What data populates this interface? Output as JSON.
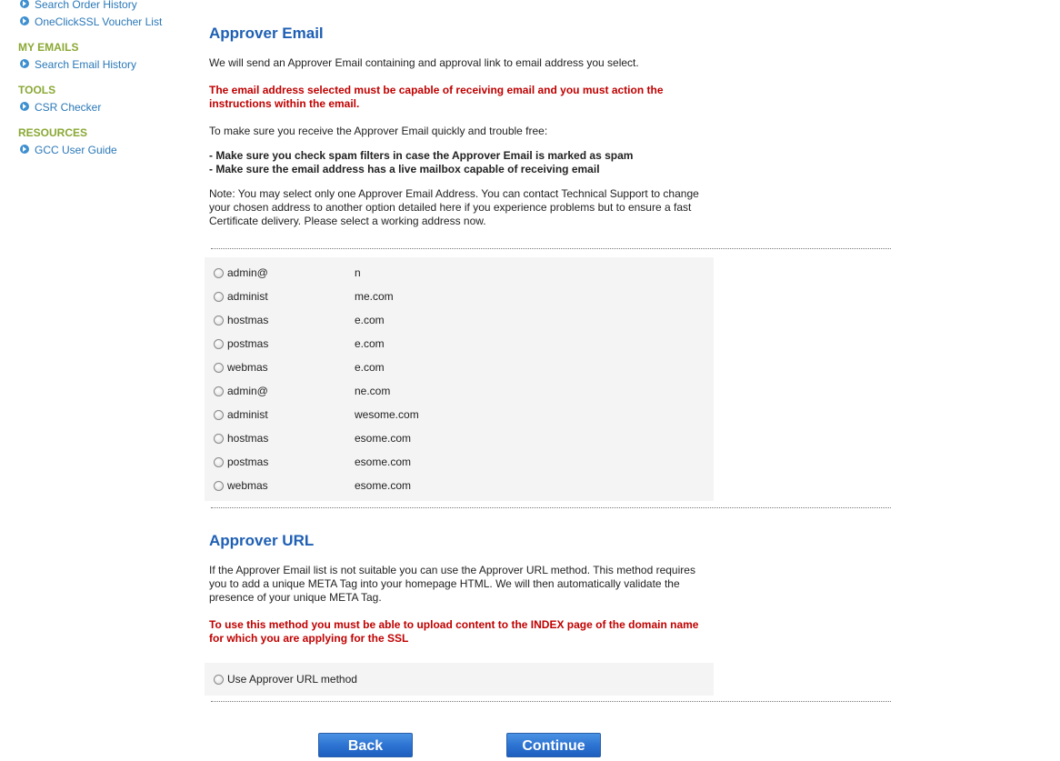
{
  "sidebar": {
    "links_top": [
      "Search Order History",
      "OneClickSSL Voucher List"
    ],
    "sections": [
      {
        "heading": "MY EMAILS",
        "link": "Search Email History"
      },
      {
        "heading": "TOOLS",
        "link": "CSR Checker"
      },
      {
        "heading": "RESOURCES",
        "link": "GCC User Guide"
      }
    ]
  },
  "approver_email": {
    "title": "Approver Email",
    "intro": "We will send an Approver Email containing and approval link to email address you select.",
    "warning": "The email address selected must be capable of receiving email and you must action the instructions within the email.",
    "tips_lead": "To make sure you receive the Approver Email quickly and trouble free:",
    "tip1": "- Make sure you check spam filters in case the Approver Email is marked as spam",
    "tip2": "- Make sure the email address has a live mailbox capable of receiving email",
    "note": "Note: You may select only one Approver Email Address. You can contact Technical Support to change your chosen address to another option detailed here if you experience problems but to ensure a fast Certificate delivery. Please select a working address now.",
    "options": [
      {
        "prefix": "admin@",
        "suffix": "n"
      },
      {
        "prefix": "administ",
        "suffix": "me.com"
      },
      {
        "prefix": "hostmas",
        "suffix": "e.com"
      },
      {
        "prefix": "postmas",
        "suffix": "e.com"
      },
      {
        "prefix": "webmas",
        "suffix": "e.com"
      },
      {
        "prefix": "admin@",
        "suffix": "ne.com"
      },
      {
        "prefix": "administ",
        "suffix": "wesome.com"
      },
      {
        "prefix": "hostmas",
        "suffix": "esome.com"
      },
      {
        "prefix": "postmas",
        "suffix": "esome.com"
      },
      {
        "prefix": "webmas",
        "suffix": "esome.com"
      }
    ]
  },
  "approver_url": {
    "title": "Approver URL",
    "desc": "If the Approver Email list is not suitable you can use the Approver URL method. This method requires you to add a unique META Tag into your homepage HTML. We will then automatically validate the presence of your unique META Tag.",
    "warning": "To use this method you must be able to upload content to the INDEX page of the domain name for which you are applying for the SSL",
    "option_label": "Use Approver URL method"
  },
  "buttons": {
    "back": "Back",
    "continue": "Continue"
  },
  "colors": {
    "link": "#2a78b8",
    "section_heading": "#8aa834",
    "title": "#1e5fb4",
    "warning": "#c00000",
    "button": "#2e74d2"
  }
}
